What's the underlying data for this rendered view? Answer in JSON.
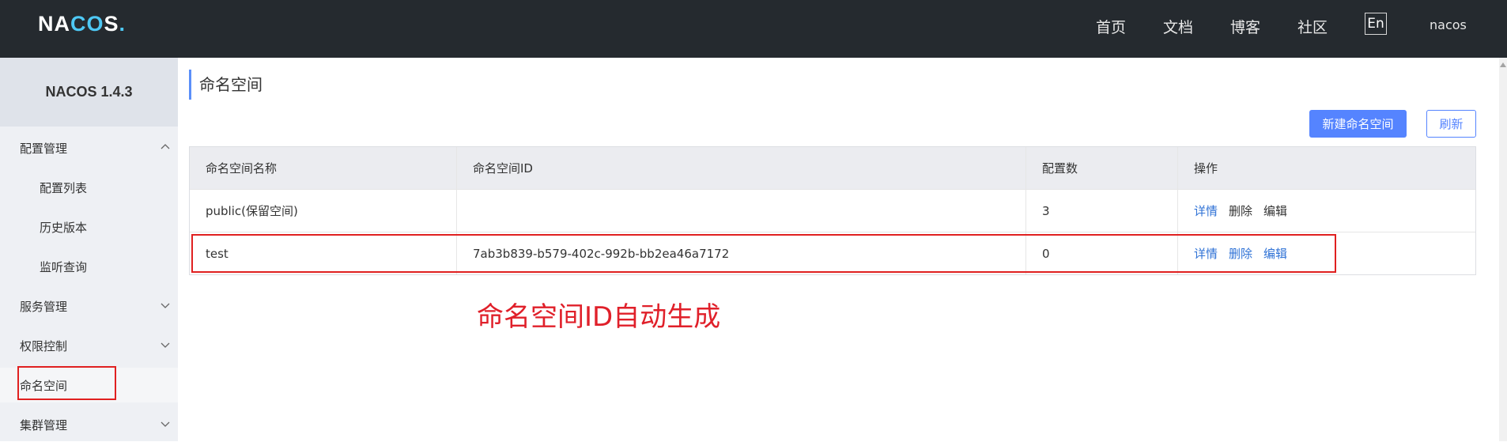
{
  "header": {
    "logo_text": "NACOS.",
    "nav": [
      "首页",
      "文档",
      "博客",
      "社区"
    ],
    "lang": "En",
    "user": "nacos"
  },
  "sidebar": {
    "brand": "NACOS 1.4.3",
    "items": [
      {
        "label": "配置管理",
        "expanded": true,
        "level": 1
      },
      {
        "label": "配置列表",
        "level": 2
      },
      {
        "label": "历史版本",
        "level": 2
      },
      {
        "label": "监听查询",
        "level": 2
      },
      {
        "label": "服务管理",
        "expanded": false,
        "level": 1
      },
      {
        "label": "权限控制",
        "expanded": false,
        "level": 1
      },
      {
        "label": "命名空间",
        "level": 1,
        "active": true
      },
      {
        "label": "集群管理",
        "expanded": false,
        "level": 1
      }
    ]
  },
  "main": {
    "title": "命名空间",
    "new_button": "新建命名空间",
    "refresh_button": "刷新",
    "table": {
      "columns": [
        "命名空间名称",
        "命名空间ID",
        "配置数",
        "操作"
      ],
      "rows": [
        {
          "name": "public(保留空间)",
          "id": "",
          "count": "3",
          "actions": [
            "详情",
            "删除",
            "编辑"
          ]
        },
        {
          "name": "test",
          "id": "7ab3b839-b579-402c-992b-bb2ea46a7172",
          "count": "0",
          "actions": [
            "详情",
            "删除",
            "编辑"
          ]
        }
      ]
    },
    "annotation": "命名空间ID自动生成"
  },
  "colors": {
    "header_bg": "#252a2f",
    "primary": "#5584ff",
    "link": "#2f72d6",
    "annotation_red": "#e0202a"
  }
}
